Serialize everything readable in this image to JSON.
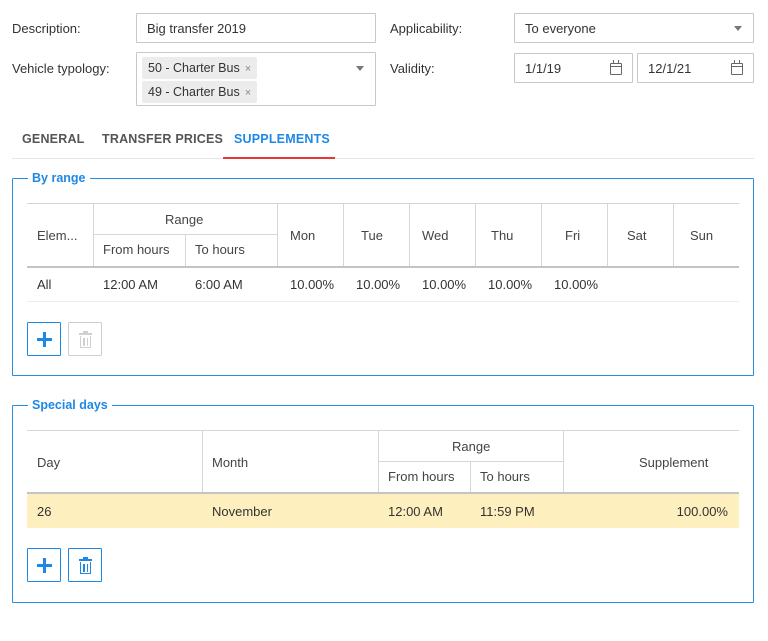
{
  "form": {
    "description_label": "Description:",
    "description_value": "Big transfer 2019",
    "applicability_label": "Applicability:",
    "applicability_value": "To everyone",
    "vehicle_label": "Vehicle typology:",
    "vehicle_tags": [
      "50 - Charter Bus",
      "49 - Charter Bus"
    ],
    "tag_remove": "×",
    "validity_label": "Validity:",
    "validity_from": "1/1/19",
    "validity_to": "12/1/21"
  },
  "tabs": [
    {
      "label": "GENERAL",
      "active": false
    },
    {
      "label": "TRANSFER PRICES",
      "active": false
    },
    {
      "label": "SUPPLEMENTS",
      "active": true
    }
  ],
  "by_range": {
    "title": "By range",
    "headers": {
      "element": "Elem...",
      "range": "Range",
      "from_hours": "From hours",
      "to_hours": "To hours",
      "days": [
        "Mon",
        "Tue",
        "Wed",
        "Thu",
        "Fri",
        "Sat",
        "Sun"
      ]
    },
    "rows": [
      {
        "element": "All",
        "from": "12:00 AM",
        "to": "6:00 AM",
        "days": [
          "10.00%",
          "10.00%",
          "10.00%",
          "10.00%",
          "10.00%",
          "",
          ""
        ]
      }
    ]
  },
  "special_days": {
    "title": "Special days",
    "headers": {
      "day": "Day",
      "month": "Month",
      "range": "Range",
      "from_hours": "From hours",
      "to_hours": "To hours",
      "supplement": "Supplement"
    },
    "rows": [
      {
        "day": "26",
        "month": "November",
        "from": "12:00 AM",
        "to": "11:59 PM",
        "supplement": "100.00%"
      }
    ]
  },
  "colors": {
    "accent": "#1e88e5",
    "tab_underline": "#e53935",
    "selected_row": "#fdefbe"
  }
}
